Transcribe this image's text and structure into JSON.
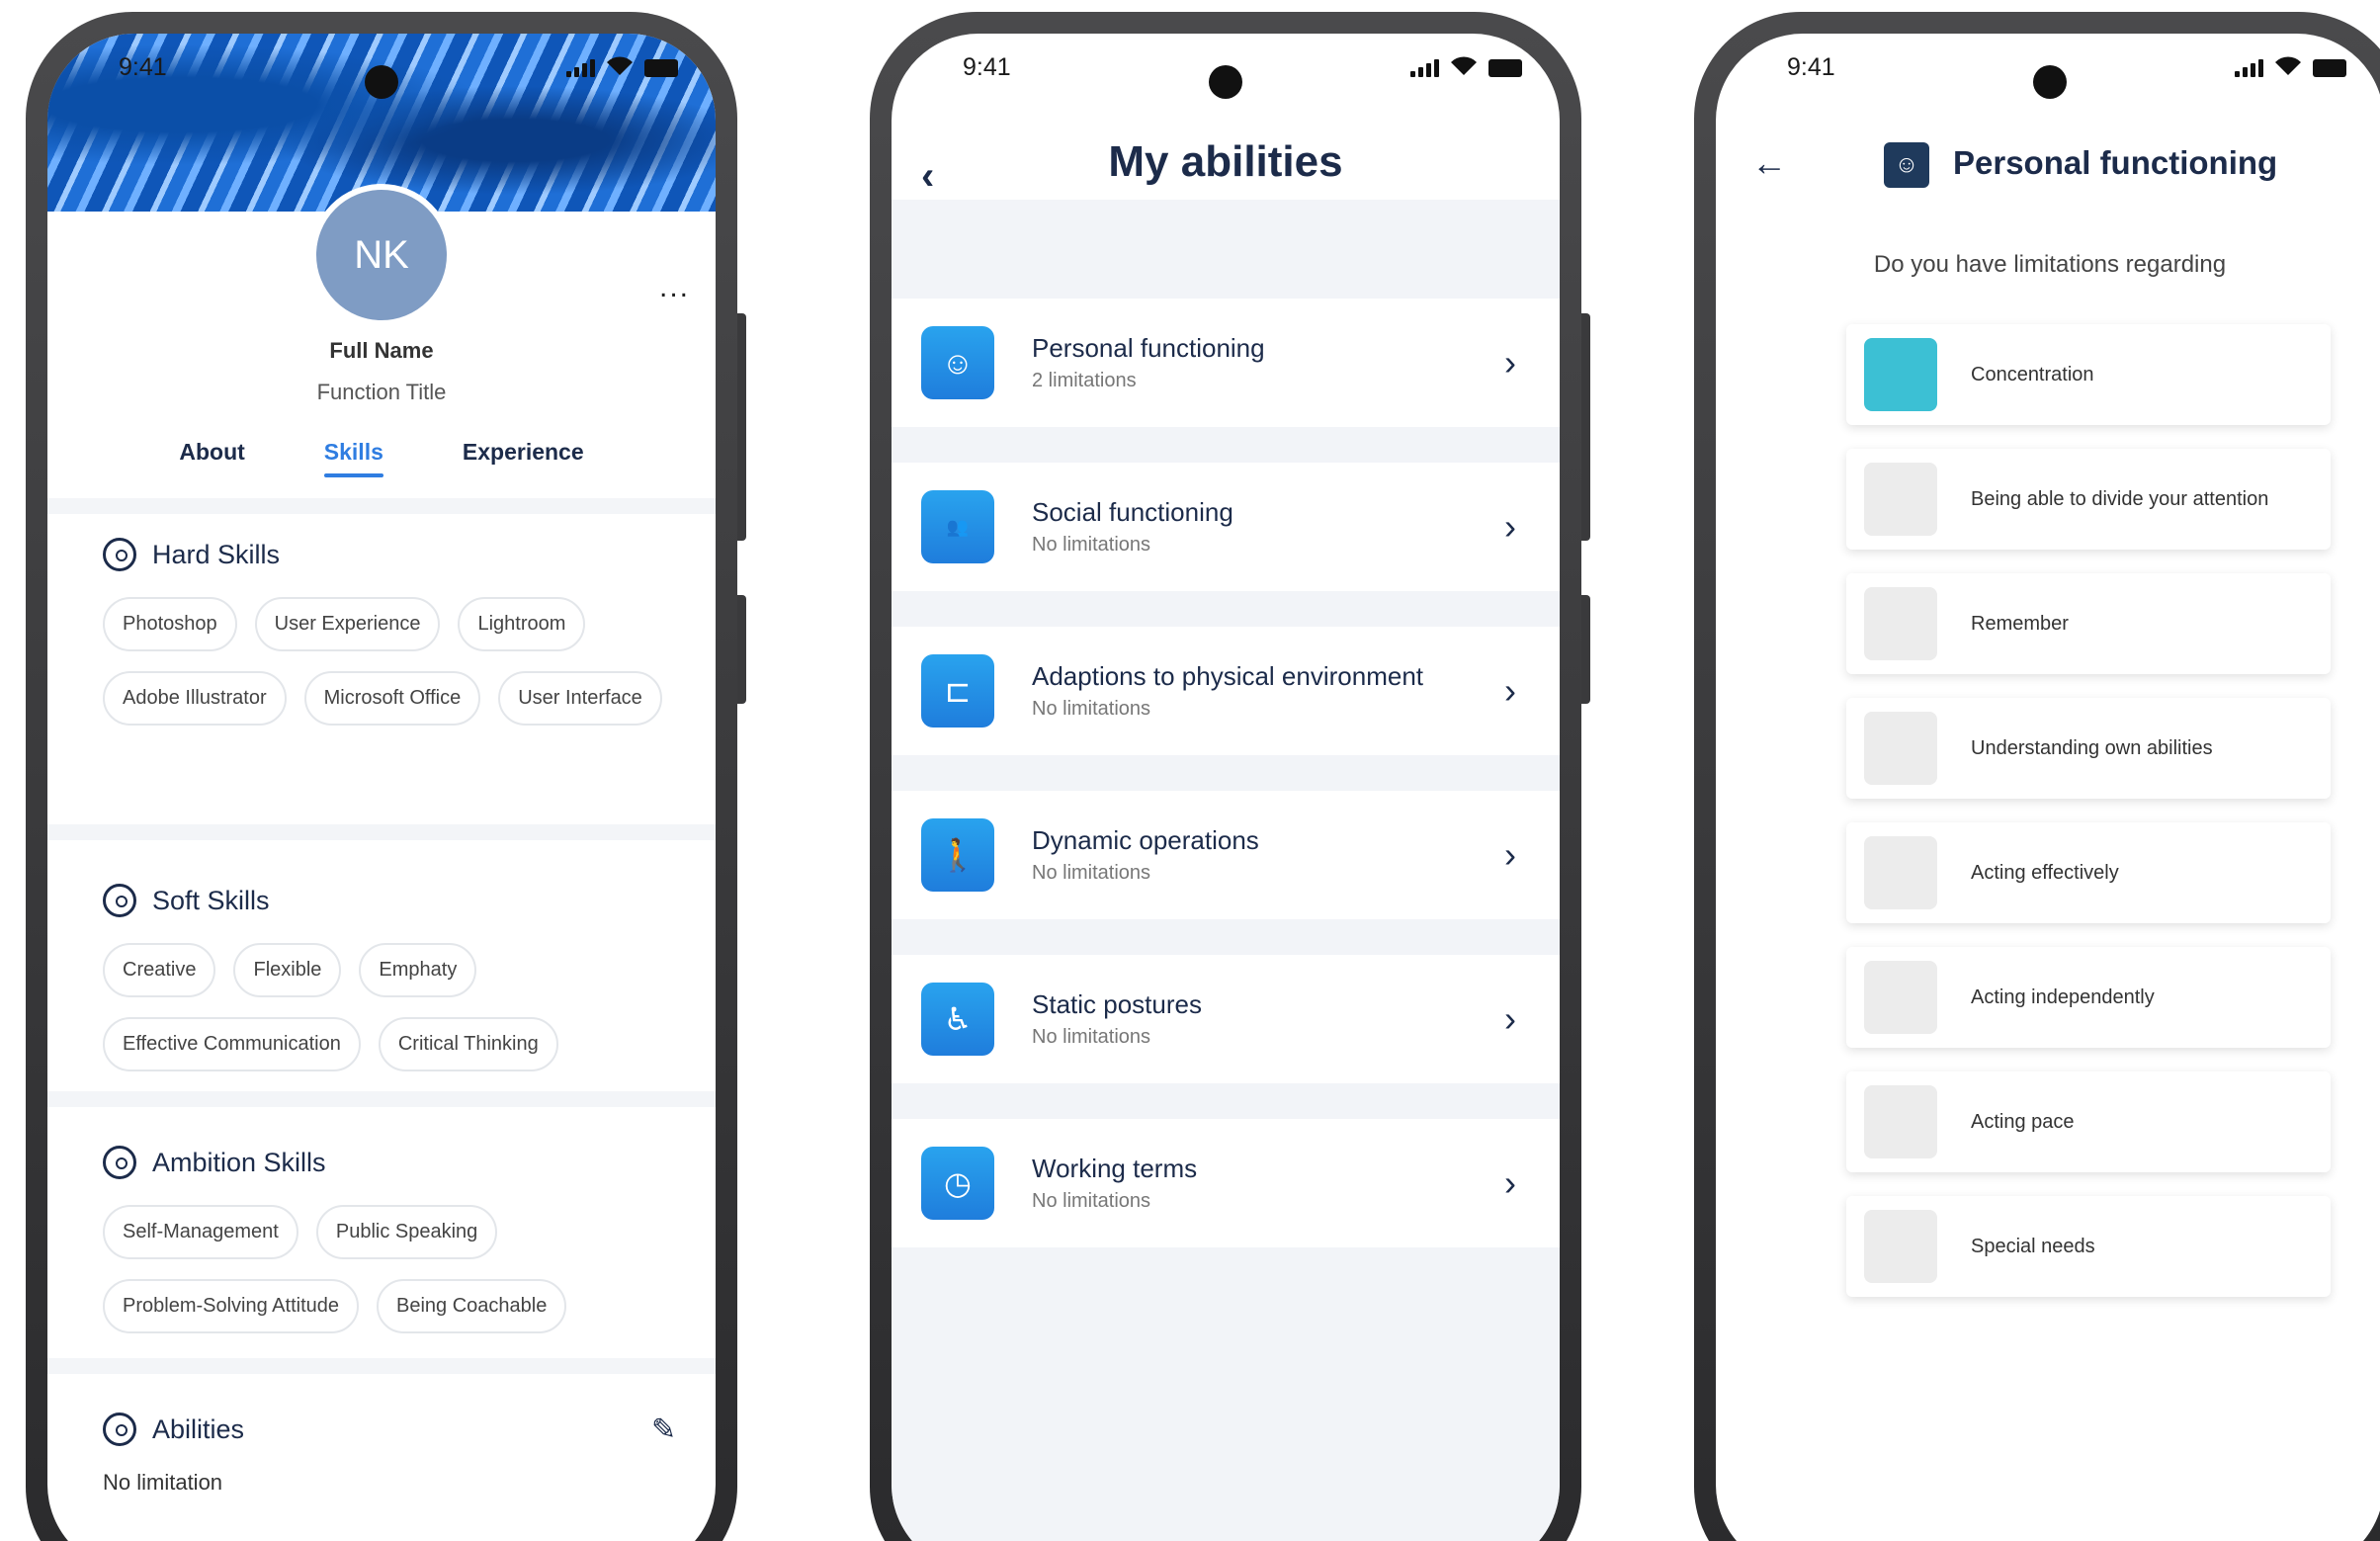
{
  "status": {
    "time": "9:41"
  },
  "profile": {
    "initials": "NK",
    "more_label": "...",
    "full_name": "Full Name",
    "function_title": "Function Title",
    "tabs": [
      "About",
      "Skills",
      "Experience"
    ],
    "active_tab": "Skills",
    "hard_skills": {
      "title": "Hard Skills",
      "chips": [
        "Photoshop",
        "User Experience",
        "Lightroom",
        "Adobe Illustrator",
        "Microsoft Office",
        "User Interface"
      ]
    },
    "soft_skills": {
      "title": "Soft Skills",
      "chips": [
        "Creative",
        "Flexible",
        "Emphaty",
        "Effective Communication",
        "Critical Thinking"
      ]
    },
    "ambition_skills": {
      "title": "Ambition Skills",
      "chips": [
        "Self-Management",
        "Public Speaking",
        "Problem-Solving Attitude",
        "Being Coachable"
      ]
    },
    "abilities": {
      "title": "Abilities",
      "value": "No limitation"
    }
  },
  "abilities_screen": {
    "title": "My abilities",
    "back_icon": "chevron-left-icon",
    "items": [
      {
        "name": "Personal functioning",
        "sub": "2 limitations",
        "icon": "smiley-icon"
      },
      {
        "name": "Social functioning",
        "sub": "No limitations",
        "icon": "people-icon"
      },
      {
        "name": "Adaptions to physical environment",
        "sub": "No limitations",
        "icon": "door-icon"
      },
      {
        "name": "Dynamic operations",
        "sub": "No limitations",
        "icon": "person-walking-icon"
      },
      {
        "name": "Static postures",
        "sub": "No limitations",
        "icon": "person-sitting-icon"
      },
      {
        "name": "Working terms",
        "sub": "No limitations",
        "icon": "clock-icon"
      }
    ]
  },
  "personal_screen": {
    "title": "Personal functioning",
    "back_icon": "arrow-left-icon",
    "question": "Do you have limitations regarding",
    "options": [
      {
        "label": "Concentration",
        "selected": true
      },
      {
        "label": "Being able to divide your attention",
        "selected": false
      },
      {
        "label": "Remember",
        "selected": false
      },
      {
        "label": "Understanding own abilities",
        "selected": false
      },
      {
        "label": "Acting effectively",
        "selected": false
      },
      {
        "label": "Acting independently",
        "selected": false
      },
      {
        "label": "Acting pace",
        "selected": false
      },
      {
        "label": "Special needs",
        "selected": false
      }
    ]
  },
  "colors": {
    "accent": "#2f7de1",
    "navy": "#1c2b4a",
    "teal": "#3cc0d4"
  }
}
